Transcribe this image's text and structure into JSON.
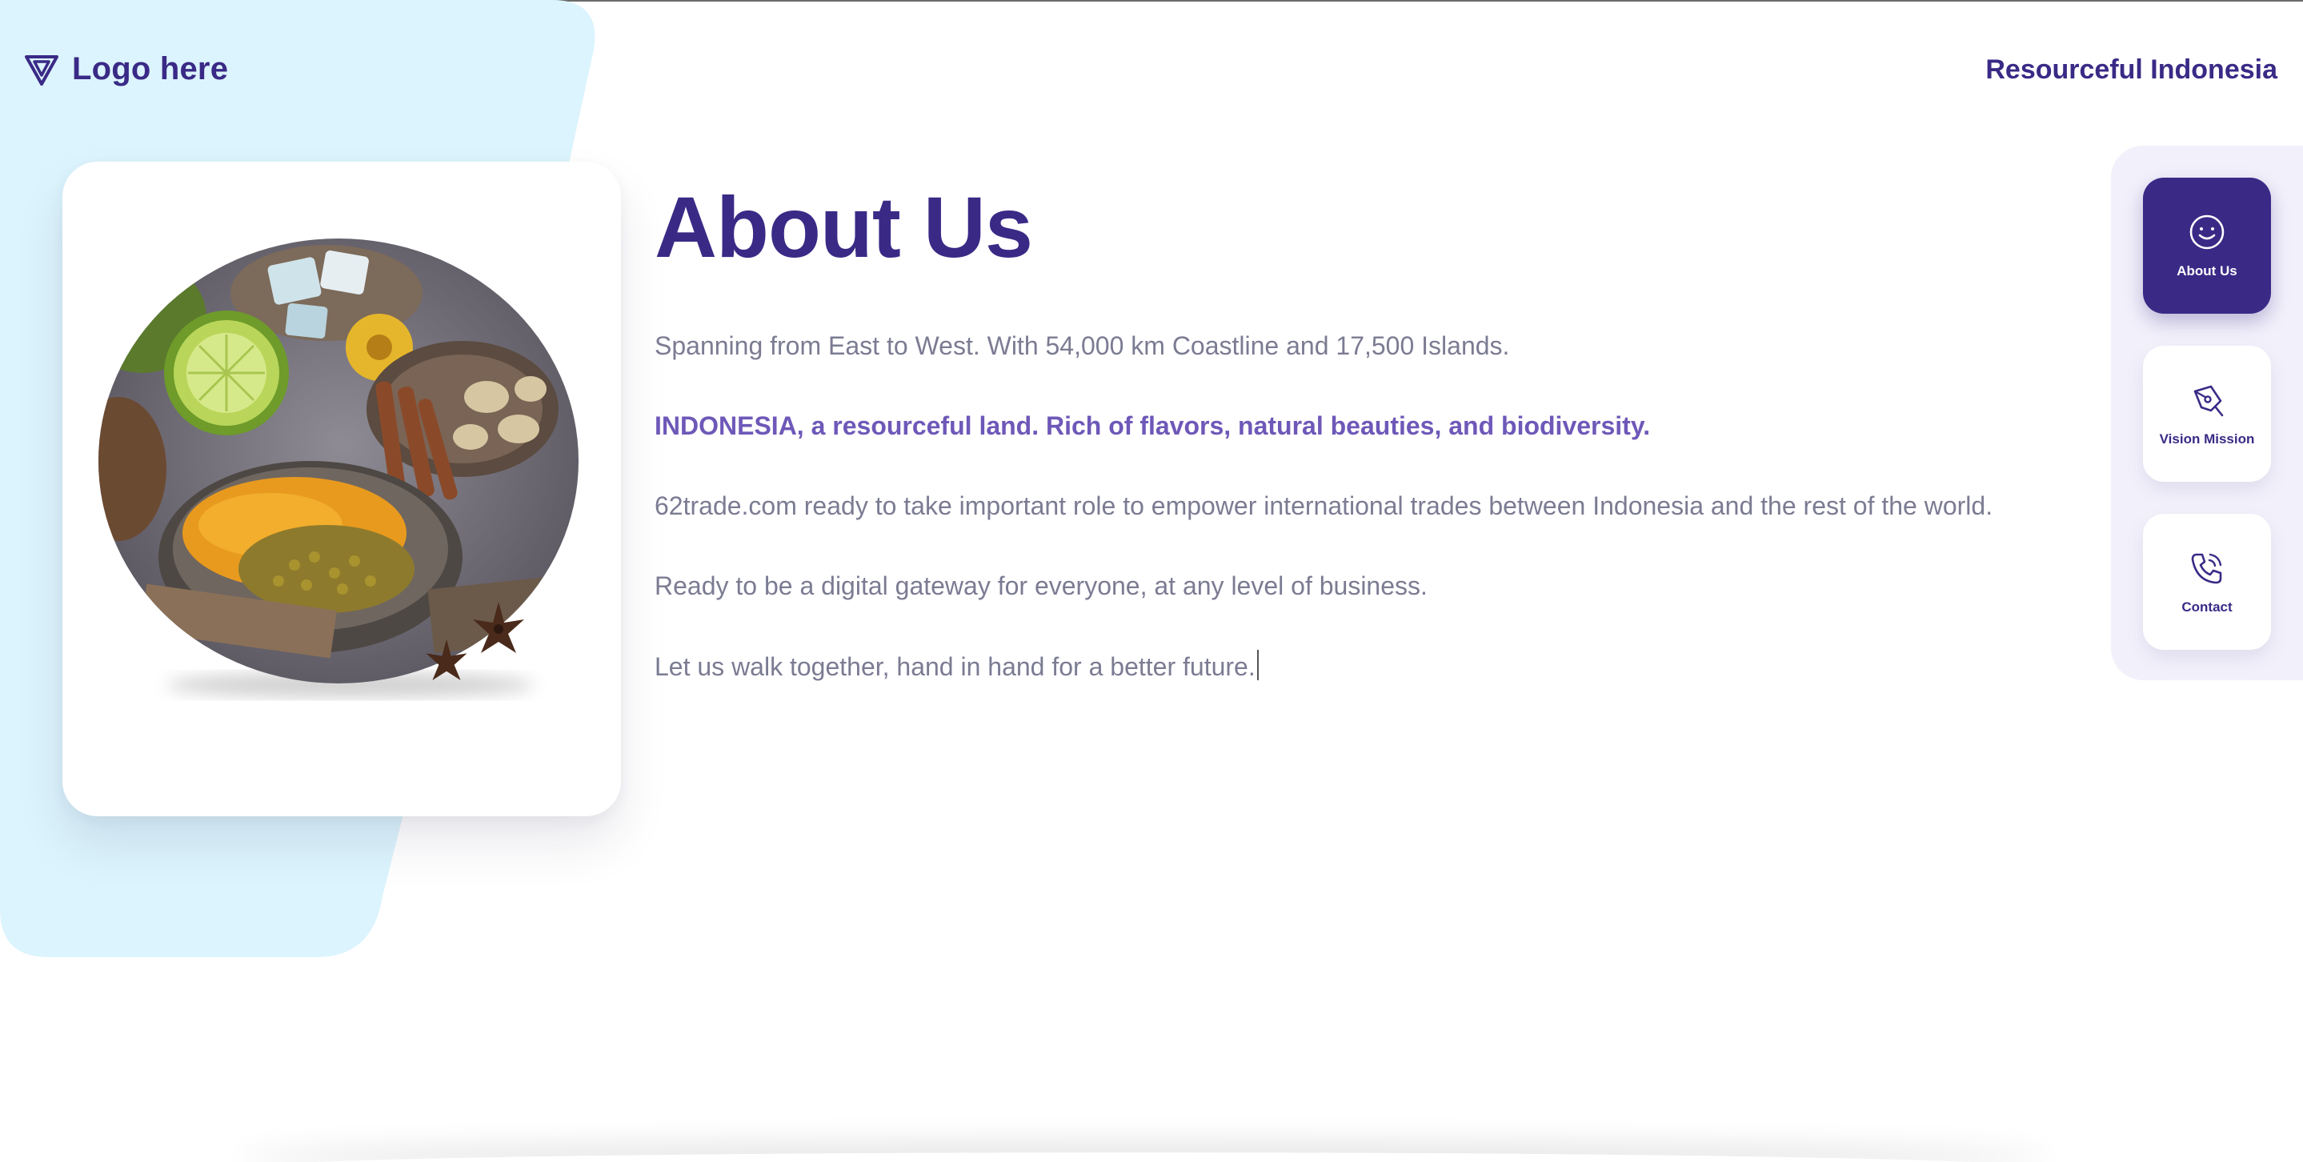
{
  "header": {
    "logo_text": "Logo here",
    "logo_icon": "triangle-logo-icon",
    "tagline": "Resourceful Indonesia"
  },
  "main": {
    "title": "About Us",
    "paragraphs": [
      "Spanning from East to West. With 54,000 km Coastline and 17,500 Islands.",
      "INDONESIA, a resourceful land. Rich of flavors, natural beauties, and biodiversity.",
      "62trade.com ready to take important role to empower international trades between Indonesia and the rest of the world.",
      "Ready to be a digital gateway for everyone, at any level of business.",
      "Let us walk together, hand in hand for a better future."
    ]
  },
  "side_nav": {
    "items": [
      {
        "label": "About Us",
        "icon": "smile-icon",
        "active": true
      },
      {
        "label": "Vision Mission",
        "icon": "pen-nib-icon",
        "active": false
      },
      {
        "label": "Contact",
        "icon": "phone-icon",
        "active": false
      }
    ]
  },
  "colors": {
    "primary": "#3a2a86",
    "accent_text": "#6e58b8",
    "body_text": "#7b7b93",
    "bg_shape": "#dcf4fd",
    "rail": "#f2f1fb"
  }
}
